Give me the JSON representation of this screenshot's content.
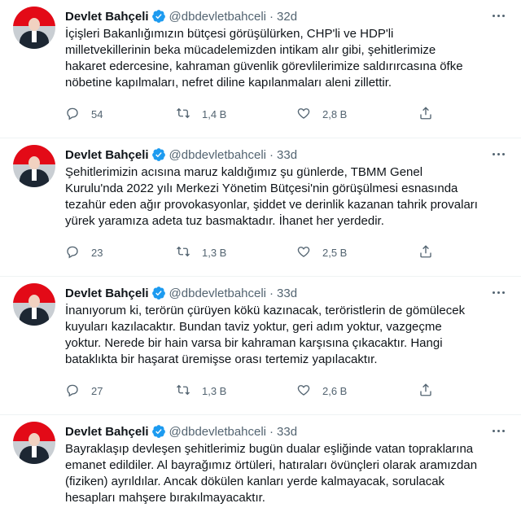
{
  "tweets": [
    {
      "name": "Devlet Bahçeli",
      "handle": "@dbdevletbahceli",
      "time": "32d",
      "lines": [
        "İçişleri Bakanlığımızın bütçesi görüşülürken, CHP'li ve HDP'li",
        "milletvekillerinin beka mücadelemizden intikam alır gibi, şehitlerimize",
        "hakaret edercesine, kahraman güvenlik görevlilerimize saldırırcasına öfke",
        "nöbetine kapılmaları, nefret diline kapılanmaları aleni zillettir."
      ],
      "replies": "54",
      "retweets": "1,4 B",
      "likes": "2,8 B"
    },
    {
      "name": "Devlet Bahçeli",
      "handle": "@dbdevletbahceli",
      "time": "33d",
      "lines": [
        "Şehitlerimizin acısına maruz kaldığımız şu günlerde, TBMM Genel",
        "Kurulu'nda 2022 yılı Merkezi Yönetim Bütçesi'nin görüşülmesi esnasında",
        "tezahür eden ağır provokasyonlar, şiddet ve derinlik kazanan tahrik provaları",
        "yürek yaramıza adeta tuz basmaktadır. İhanet her yerdedir."
      ],
      "replies": "23",
      "retweets": "1,3 B",
      "likes": "2,5 B"
    },
    {
      "name": "Devlet Bahçeli",
      "handle": "@dbdevletbahceli",
      "time": "33d",
      "lines": [
        "İnanıyorum ki, terörün çürüyen kökü kazınacak, teröristlerin de gömülecek",
        "kuyuları kazılacaktır. Bundan taviz yoktur, geri adım yoktur, vazgeçme",
        "yoktur. Nerede bir hain varsa bir kahraman karşısına çıkacaktır. Hangi",
        "bataklıkta bir haşarat üremişse orası tertemiz yapılacaktır."
      ],
      "replies": "27",
      "retweets": "1,3 B",
      "likes": "2,6 B"
    },
    {
      "name": "Devlet Bahçeli",
      "handle": "@dbdevletbahceli",
      "time": "33d",
      "lines": [
        "Bayraklaşıp devleşen şehitlerimiz bugün dualar eşliğinde vatan topraklarına",
        "emanet edildiler. Al bayrağımız örtüleri, hatıraları övünçleri olarak aramızdan",
        "(fiziken) ayrıldılar. Ancak dökülen kanları yerde kalmayacak, sorulacak",
        "hesapları mahşere bırakılmayacaktır."
      ],
      "replies": "",
      "retweets": "",
      "likes": ""
    }
  ],
  "colors": {
    "verified": "#1d9bf0",
    "secondary_text": "#536471",
    "text": "#0f1419"
  }
}
